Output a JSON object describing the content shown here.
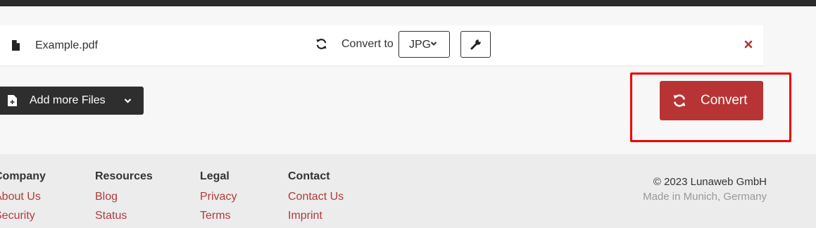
{
  "file": {
    "name": "Example.pdf",
    "icon": "file-icon"
  },
  "conversion": {
    "label": "Convert to",
    "format": "JPG"
  },
  "actions": {
    "add_files_label": "Add more Files",
    "convert_label": "Convert"
  },
  "footer": {
    "columns": [
      {
        "heading": "Company",
        "links": [
          "About Us",
          "Security"
        ]
      },
      {
        "heading": "Resources",
        "links": [
          "Blog",
          "Status"
        ]
      },
      {
        "heading": "Legal",
        "links": [
          "Privacy",
          "Terms"
        ]
      },
      {
        "heading": "Contact",
        "links": [
          "Contact Us",
          "Imprint"
        ]
      }
    ],
    "copyright": "© 2023 Lunaweb GmbH",
    "location": "Made in Munich, Germany"
  },
  "colors": {
    "accent": "#b83434",
    "dark_button": "#2e2e2e",
    "highlight": "#ee0000",
    "link": "#b23b3b"
  }
}
